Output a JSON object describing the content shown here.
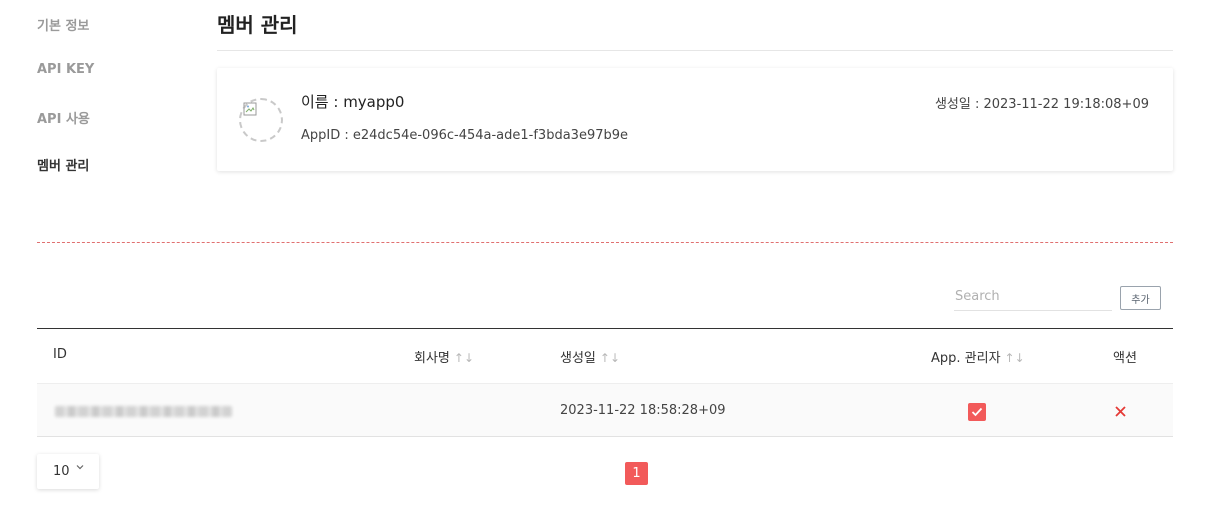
{
  "sidebar": {
    "items": [
      {
        "label": "기본 정보",
        "active": false
      },
      {
        "label": "API KEY",
        "active": false
      },
      {
        "label": "API 사용",
        "active": false
      },
      {
        "label": "멤버 관리",
        "active": true
      }
    ]
  },
  "page": {
    "title": "멤버 관리"
  },
  "app": {
    "name": "이름 : myapp0",
    "app_id": "AppID : e24dc54e-096c-454a-ade1-f3bda3e97b9e",
    "created": "생성일 : 2023-11-22 19:18:08+09"
  },
  "toolbar": {
    "search_placeholder": "Search",
    "search_value": "",
    "add_label": "추가"
  },
  "table": {
    "columns": {
      "id": "ID",
      "company": "회사명",
      "created": "생성일",
      "admin": "App. 관리자",
      "action": "액션"
    },
    "sort_icon": "↑↓",
    "rows": [
      {
        "id": "",
        "company": "",
        "created": "2023-11-22 18:58:28+09",
        "admin": true
      }
    ]
  },
  "pagination": {
    "page_size": "10",
    "current_page": "1"
  },
  "colors": {
    "accent": "#f25a5a",
    "danger": "#e53935",
    "divider_dashed": "#e07070"
  },
  "icons": {
    "avatar": "broken-image-icon",
    "check": "check-icon",
    "delete": "close-icon",
    "page_size": "chevron-down-icon"
  }
}
